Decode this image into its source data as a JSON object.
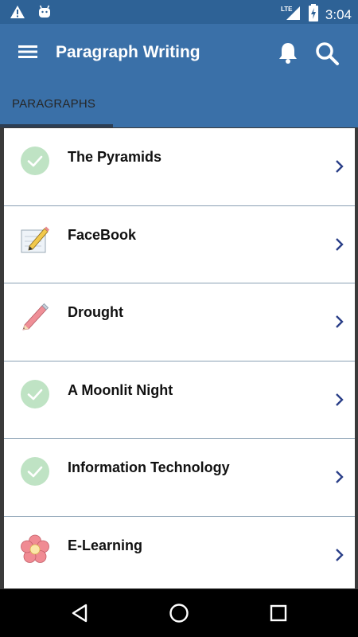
{
  "status_bar": {
    "time": "3:04",
    "network": "LTE",
    "icons": [
      "warning-icon",
      "android-icon",
      "lte-signal-icon",
      "battery-charging-icon"
    ]
  },
  "app_bar": {
    "title": "Paragraph Writing",
    "icons": [
      "menu-icon",
      "bell-icon",
      "search-icon"
    ]
  },
  "tabs": [
    {
      "label": "PARAGRAPHS",
      "selected": true
    }
  ],
  "paragraphs": [
    {
      "title": "The Pyramids",
      "icon": "check-circle-icon"
    },
    {
      "title": "FaceBook",
      "icon": "notepad-pencil-icon"
    },
    {
      "title": "Drought",
      "icon": "pencil-icon"
    },
    {
      "title": "A Moonlit Night",
      "icon": "check-circle-icon"
    },
    {
      "title": "Information Technology",
      "icon": "check-circle-icon"
    },
    {
      "title": "E-Learning",
      "icon": "flower-icon"
    }
  ],
  "nav_bar": {
    "icons": [
      "back-icon",
      "home-icon",
      "recents-icon"
    ]
  },
  "colors": {
    "status_bar": "#2e6296",
    "app_bar": "#3a70a8",
    "tab_indicator": "#2c3e54",
    "check_circle": "#bfe3c4",
    "chevron": "#2a3f88"
  }
}
